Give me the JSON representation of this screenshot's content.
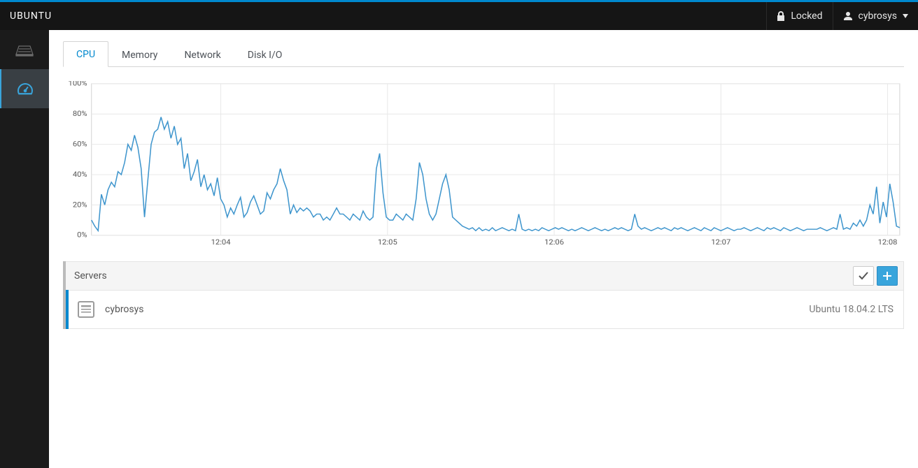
{
  "topbar": {
    "title": "UBUNTU",
    "locked": "Locked",
    "user": "cybrosys"
  },
  "sidebar": {
    "items": [
      {
        "icon": "server-stack-icon"
      },
      {
        "icon": "dashboard-icon"
      }
    ],
    "active_index": 1
  },
  "tabs": {
    "items": [
      {
        "label": "CPU"
      },
      {
        "label": "Memory"
      },
      {
        "label": "Network"
      },
      {
        "label": "Disk I/O"
      }
    ],
    "active_index": 0
  },
  "servers_panel": {
    "title": "Servers",
    "rows": [
      {
        "name": "cybrosys",
        "os": "Ubuntu 18.04.2 LTS"
      }
    ]
  },
  "chart_data": {
    "type": "line",
    "title": "",
    "xlabel": "",
    "ylabel": "",
    "y_ticks": [
      "0%",
      "20%",
      "40%",
      "60%",
      "80%",
      "100%"
    ],
    "ylim": [
      0,
      100
    ],
    "x_ticks": [
      "12:04",
      "12:05",
      "12:06",
      "12:07",
      "12:08"
    ],
    "x_start": "12:03:32",
    "x_end": "12:08:08",
    "series": [
      {
        "name": "CPU %",
        "color": "#3e95cd",
        "samples": [
          10,
          6,
          3,
          27,
          20,
          30,
          35,
          32,
          42,
          40,
          48,
          60,
          56,
          66,
          58,
          44,
          12,
          36,
          60,
          68,
          70,
          78,
          70,
          75,
          64,
          72,
          60,
          64,
          44,
          54,
          36,
          42,
          50,
          32,
          40,
          30,
          34,
          26,
          38,
          24,
          20,
          12,
          18,
          14,
          20,
          25,
          12,
          15,
          22,
          26,
          20,
          14,
          16,
          28,
          24,
          30,
          34,
          44,
          36,
          30,
          14,
          20,
          15,
          18,
          16,
          18,
          16,
          12,
          14,
          14,
          10,
          12,
          10,
          14,
          18,
          14,
          14,
          12,
          10,
          14,
          12,
          10,
          16,
          12,
          10,
          12,
          44,
          54,
          28,
          12,
          10,
          10,
          14,
          12,
          10,
          14,
          12,
          10,
          24,
          48,
          40,
          24,
          14,
          10,
          14,
          24,
          34,
          40,
          30,
          12,
          10,
          8,
          6,
          5,
          4,
          5,
          3,
          5,
          3,
          4,
          3,
          5,
          3,
          4,
          5,
          4,
          3,
          4,
          3,
          14,
          4,
          3,
          4,
          3,
          4,
          3,
          5,
          4,
          3,
          4,
          5,
          4,
          5,
          4,
          3,
          4,
          3,
          4,
          5,
          4,
          3,
          4,
          5,
          4,
          3,
          4,
          3,
          4,
          5,
          4,
          5,
          4,
          3,
          4,
          14,
          6,
          4,
          5,
          4,
          3,
          4,
          5,
          4,
          5,
          4,
          3,
          5,
          4,
          5,
          4,
          3,
          4,
          5,
          4,
          3,
          5,
          4,
          3,
          5,
          4,
          3,
          4,
          5,
          4,
          3,
          4,
          4,
          5,
          4,
          3,
          4,
          5,
          4,
          3,
          5,
          4,
          5,
          4,
          3,
          5,
          4,
          3,
          4,
          5,
          4,
          3,
          4,
          4,
          4,
          4,
          5,
          4,
          3,
          4,
          5,
          4,
          14,
          4,
          5,
          4,
          8,
          6,
          10,
          6,
          10,
          20,
          14,
          32,
          8,
          22,
          12,
          34,
          22,
          6,
          5
        ]
      }
    ]
  }
}
